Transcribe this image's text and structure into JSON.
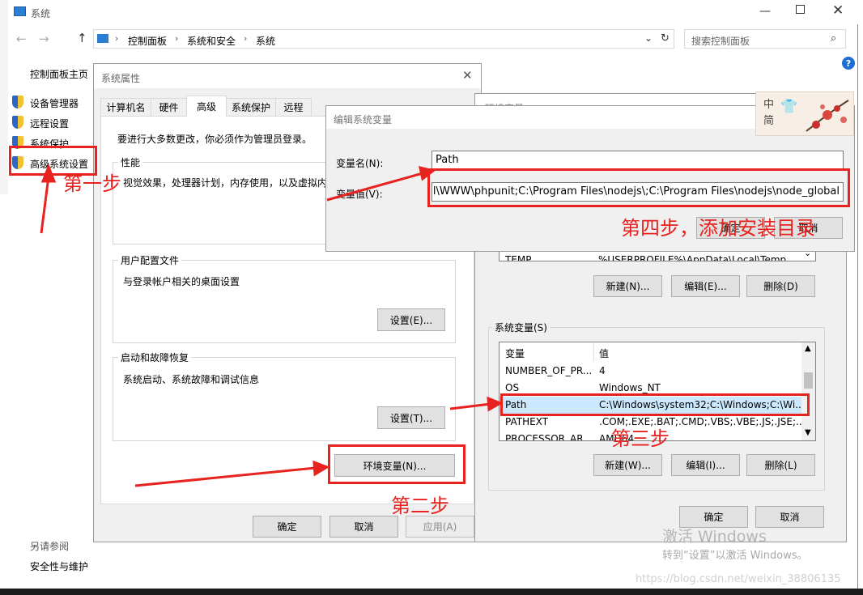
{
  "window": {
    "title": "系统",
    "address": {
      "path": [
        "控制面板",
        "系统和安全",
        "系统"
      ],
      "search_placeholder": "搜索控制面板"
    }
  },
  "left_nav": {
    "home": "控制面板主页",
    "items": [
      "设备管理器",
      "远程设置",
      "系统保护",
      "高级系统设置"
    ],
    "see_also_title": "另请参阅",
    "see_also_items": [
      "安全性与维护"
    ]
  },
  "sys_props": {
    "title": "系统属性",
    "tabs": [
      "计算机名",
      "硬件",
      "高级",
      "系统保护",
      "远程"
    ],
    "admin_note": "要进行大多数更改，你必须作为管理员登录。",
    "performance": {
      "title": "性能",
      "desc": "视觉效果，处理器计划，内存使用，以及虚拟内"
    },
    "profile": {
      "title": "用户配置文件",
      "desc": "与登录帐户相关的桌面设置",
      "settings_btn": "设置(E)..."
    },
    "startup": {
      "title": "启动和故障恢复",
      "desc": "系统启动、系统故障和调试信息",
      "settings_btn": "设置(T)..."
    },
    "env_btn": "环境变量(N)...",
    "ok": "确定",
    "cancel": "取消",
    "apply": "应用(A)"
  },
  "env_dialog": {
    "title_partial": "环境变量",
    "user_list_row": {
      "name": "TEMP",
      "value": "%USERPROFILE%\\AppData\\Local\\Temp"
    },
    "user_new": "新建(N)...",
    "user_edit": "编辑(E)...",
    "user_delete": "删除(D)",
    "sys_title": "系统变量(S)",
    "columns": [
      "变量",
      "值"
    ],
    "sys_rows": [
      {
        "name": "NUMBER_OF_PR...",
        "value": "4"
      },
      {
        "name": "OS",
        "value": "Windows_NT"
      },
      {
        "name": "Path",
        "value": "C:\\Windows\\system32;C:\\Windows;C:\\Wi..."
      },
      {
        "name": "PATHEXT",
        "value": ".COM;.EXE;.BAT;.CMD;.VBS;.VBE;.JS;.JSE;..."
      },
      {
        "name": "PROCESSOR_AR...",
        "value": "AMD64"
      }
    ],
    "sys_new": "新建(W)...",
    "sys_edit": "编辑(I)...",
    "sys_delete": "删除(L)",
    "ok": "确定",
    "cancel": "取消"
  },
  "edit_dialog": {
    "title": "编辑系统变量",
    "name_label": "变量名(N):",
    "value_label": "变量值(V):",
    "name_value": "Path",
    "value_value": "Tutorial\\WWW\\phpunit;C:\\Program Files\\nodejs\\;C:\\Program Files\\nodejs\\node_global",
    "ok_partial": "确定",
    "cancel_partial": "取消"
  },
  "annotations": {
    "step1": "第一步",
    "step2": "第二步",
    "step3": "第三步",
    "step4": "第四步，添加安装目录"
  },
  "ime_badge": {
    "line1": "中",
    "line2": "简"
  },
  "watermark": {
    "activate_title": "激活 Windows",
    "activate_sub": "转到“设置”以激活 Windows。",
    "url": "https://blog.csdn.net/weixin_38806135"
  },
  "colors": {
    "annotation_red": "#e8221e",
    "dialog_bg": "#f0f0f0",
    "selection": "#cce8ff"
  }
}
